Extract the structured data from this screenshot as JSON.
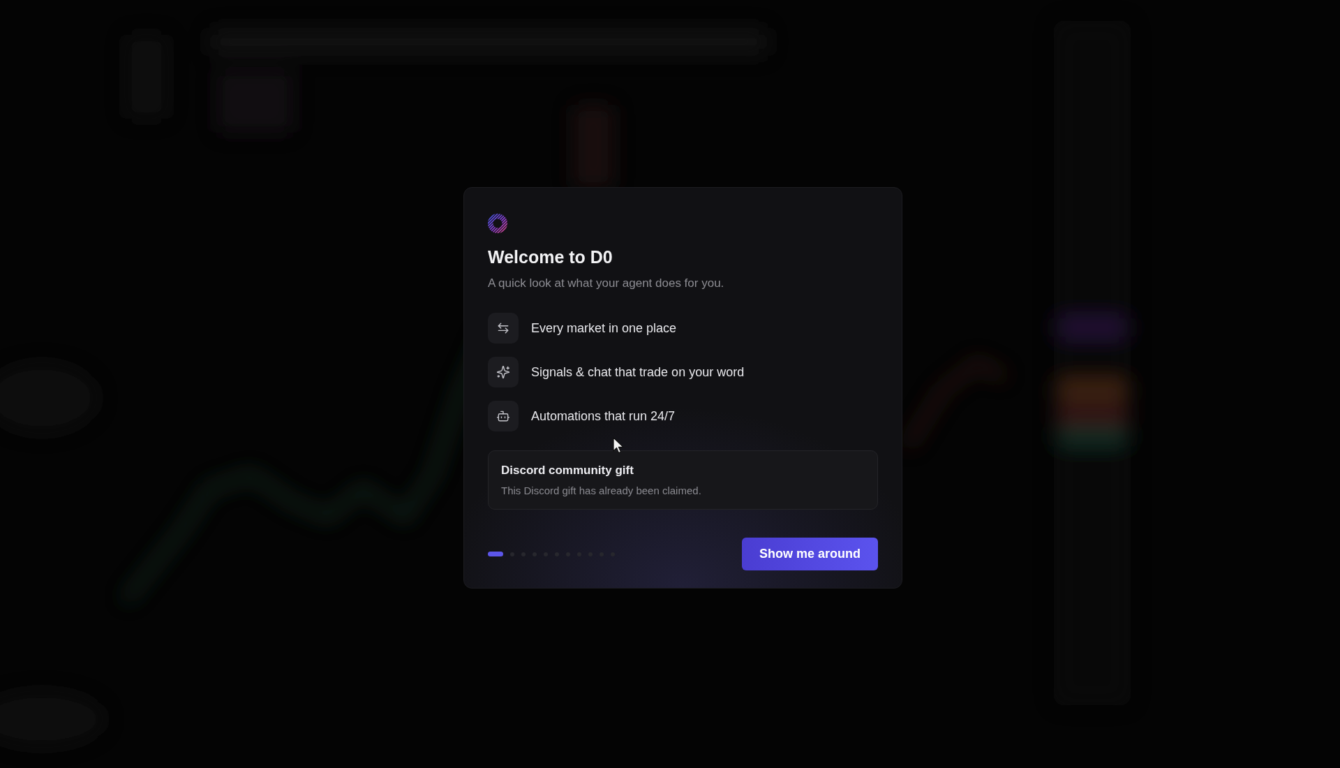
{
  "dialog": {
    "title": "Welcome to D0",
    "subtitle": "A quick look at what your agent does for you.",
    "features": [
      {
        "label": "Every market in one place"
      },
      {
        "label": "Signals & chat that trade on your word"
      },
      {
        "label": "Automations that run 24/7"
      }
    ],
    "notice": {
      "title": "Discord community gift",
      "text": "This Discord gift has already been claimed."
    },
    "steps": [
      {
        "selected": true
      },
      {
        "selected": false
      },
      {
        "selected": false
      },
      {
        "selected": false
      },
      {
        "selected": false
      },
      {
        "selected": false
      },
      {
        "selected": false
      },
      {
        "selected": false
      },
      {
        "selected": false
      },
      {
        "selected": false
      },
      {
        "selected": false
      }
    ],
    "primary_button": "Show me around"
  }
}
